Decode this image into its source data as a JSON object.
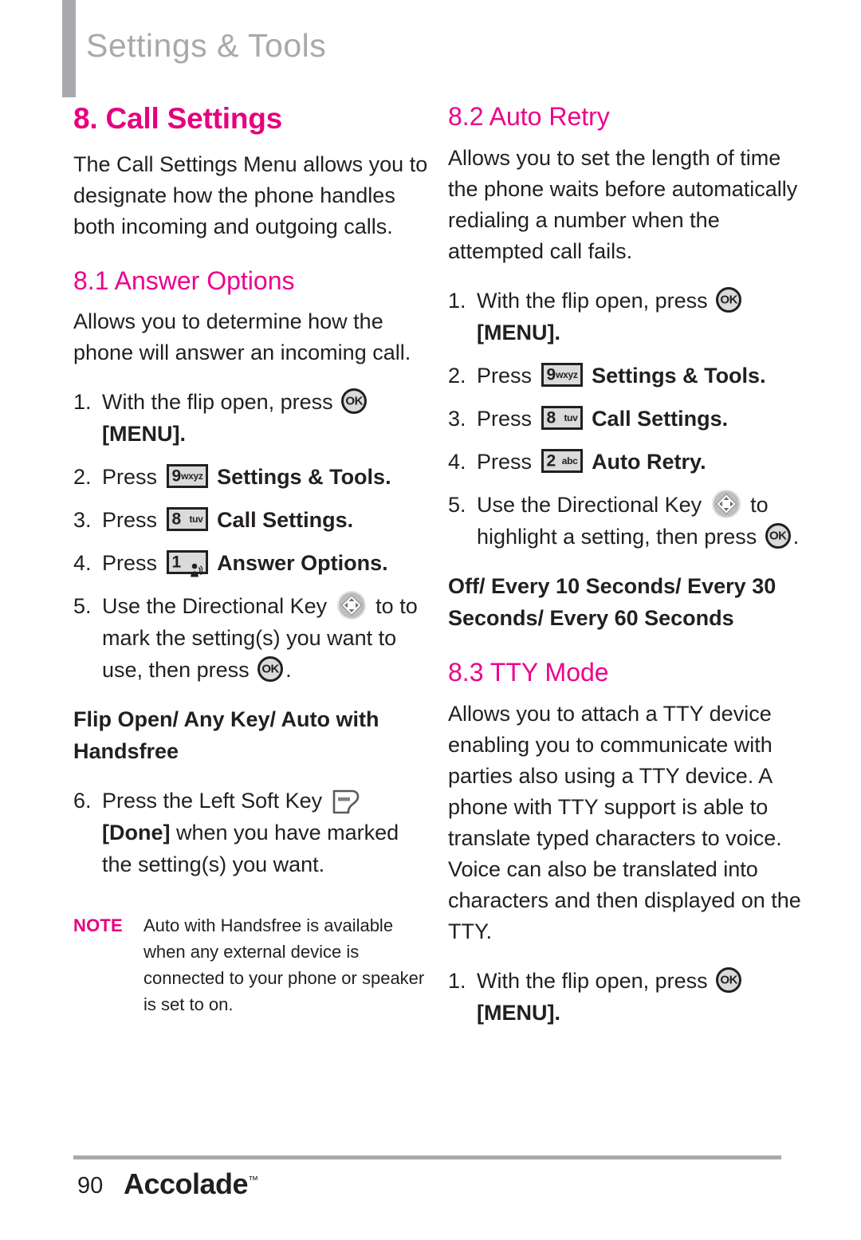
{
  "header": {
    "title": "Settings & Tools"
  },
  "left_column": {
    "chapter_heading": "8. Call Settings",
    "chapter_intro": "The Call Settings Menu allows you to designate how the phone handles both incoming and outgoing calls.",
    "section": {
      "heading": "8.1 Answer Options",
      "intro": "Allows you to determine how the phone will answer an incoming call.",
      "steps": [
        {
          "num": "1.",
          "text_before": "With the flip open, press",
          "icon": "ok-key-icon",
          "text_after": "[MENU]."
        },
        {
          "num": "2.",
          "text_before": "Press",
          "icon": "key-9-wxyz-icon",
          "key_digit": "9",
          "key_letters": "wxyz",
          "text_after": "Settings & Tools."
        },
        {
          "num": "3.",
          "text_before": "Press",
          "icon": "key-8-tuv-icon",
          "key_digit": "8",
          "key_letters": "tuv",
          "text_after": "Call Settings."
        },
        {
          "num": "4.",
          "text_before": "Press",
          "icon": "key-1-voicemail-icon",
          "key_digit": "1",
          "key_letters": "",
          "text_after": "Answer Options."
        },
        {
          "num": "5.",
          "text_before": "Use the Directional Key",
          "icon": "directional-key-icon",
          "text_after": "to to mark the setting(s) you want to use, then press",
          "icon2": "ok-key-icon",
          "text_end": "."
        },
        {
          "num": "6.",
          "text_before": "Press the Left Soft Key",
          "icon": "left-soft-key-icon",
          "text_bold": "[Done]",
          "text_after": "when you have marked the setting(s) you want."
        }
      ],
      "options": "Flip Open/ Any Key/ Auto with Handsfree"
    },
    "note": {
      "label": "NOTE",
      "text": "Auto with Handsfree is available when any external device is connected to your phone or speaker is set to on."
    }
  },
  "right_column": {
    "sections": [
      {
        "heading": "8.2 Auto Retry",
        "intro": "Allows you to set the length of time the phone waits before automatically redialing a number when the attempted call fails.",
        "steps": [
          {
            "num": "1.",
            "text_before": "With the flip open, press",
            "icon": "ok-key-icon",
            "text_after": "[MENU]."
          },
          {
            "num": "2.",
            "text_before": "Press",
            "icon": "key-9-wxyz-icon",
            "key_digit": "9",
            "key_letters": "wxyz",
            "text_after": "Settings & Tools."
          },
          {
            "num": "3.",
            "text_before": "Press",
            "icon": "key-8-tuv-icon",
            "key_digit": "8",
            "key_letters": "tuv",
            "text_after": "Call Settings."
          },
          {
            "num": "4.",
            "text_before": "Press",
            "icon": "key-2-abc-icon",
            "key_digit": "2",
            "key_letters": "abc",
            "text_after": "Auto Retry."
          },
          {
            "num": "5.",
            "text_before": "Use the Directional Key",
            "icon": "directional-key-icon",
            "text_after": "to highlight a setting, then press",
            "icon2": "ok-key-icon",
            "text_end": "."
          }
        ],
        "options": "Off/ Every 10 Seconds/ Every 30 Seconds/ Every 60 Seconds"
      },
      {
        "heading": "8.3 TTY Mode",
        "intro": "Allows you to attach a TTY device enabling you to communicate with parties also using a TTY device. A phone with TTY support is able to translate typed characters to voice. Voice can also be translated into characters and then displayed on the TTY.",
        "steps": [
          {
            "num": "1.",
            "text_before": "With the flip open, press",
            "icon": "ok-key-icon",
            "text_after": "[MENU]."
          }
        ]
      }
    ]
  },
  "footer": {
    "page_number": "90",
    "brand": "Accolade",
    "trademark": "™"
  },
  "colors": {
    "accent_magenta": "#e6007e",
    "section_magenta": "#ec008c",
    "header_gray": "#a7a9ac",
    "body_black": "#231f20",
    "key_fill": "#d9dadb"
  }
}
